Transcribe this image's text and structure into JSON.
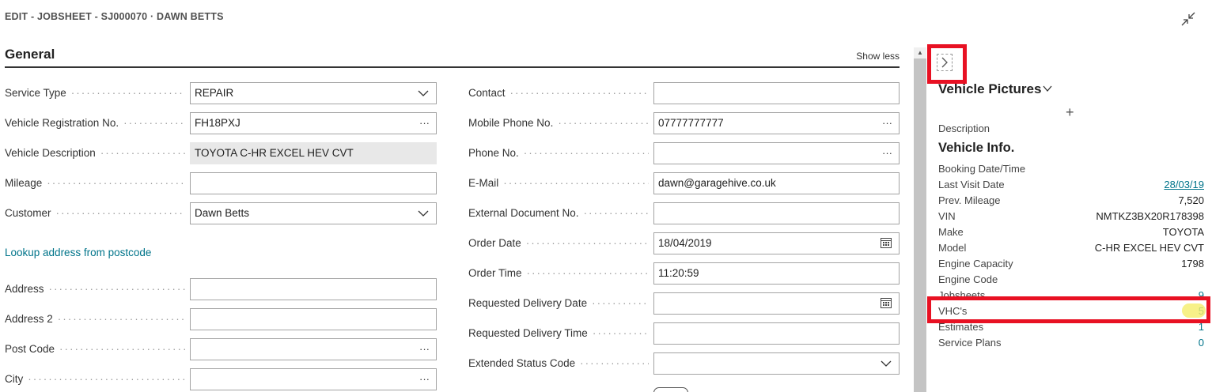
{
  "page": {
    "title": "EDIT - JOBSHEET - SJ000070 · DAWN BETTS",
    "collapse_icon": "collapse-arrows-icon"
  },
  "section": {
    "title": "General",
    "show_less": "Show less"
  },
  "left_fields": [
    {
      "label": "Service Type",
      "value": "REPAIR",
      "suffix": "chevron"
    },
    {
      "label": "Vehicle Registration No.",
      "value": "FH18PXJ",
      "suffix": "···"
    },
    {
      "label": "Vehicle Description",
      "value": "TOYOTA C-HR EXCEL HEV CVT",
      "suffix": ""
    },
    {
      "label": "Mileage",
      "value": "",
      "suffix": ""
    },
    {
      "label": "Customer",
      "value": "Dawn Betts",
      "suffix": "chevron"
    }
  ],
  "lookup_link": "Lookup address from postcode",
  "address_fields": [
    {
      "label": "Address",
      "value": "",
      "suffix": ""
    },
    {
      "label": "Address 2",
      "value": "",
      "suffix": ""
    },
    {
      "label": "Post Code",
      "value": "",
      "suffix": "···"
    },
    {
      "label": "City",
      "value": "",
      "suffix": "···"
    }
  ],
  "right_fields": [
    {
      "label": "Contact",
      "value": "",
      "suffix": ""
    },
    {
      "label": "Mobile Phone No.",
      "value": "07777777777",
      "suffix": "···"
    },
    {
      "label": "Phone No.",
      "value": "",
      "suffix": "···"
    },
    {
      "label": "E-Mail",
      "value": "dawn@garagehive.co.uk",
      "suffix": ""
    },
    {
      "label": "External Document No.",
      "value": "",
      "suffix": ""
    },
    {
      "label": "Order Date",
      "value": "18/04/2019",
      "suffix": "calendar"
    },
    {
      "label": "Order Time",
      "value": "11:20:59",
      "suffix": ""
    },
    {
      "label": "Requested Delivery Date",
      "value": "",
      "suffix": "calendar"
    },
    {
      "label": "Requested Delivery Time",
      "value": "",
      "suffix": ""
    },
    {
      "label": "Extended Status Code",
      "value": "",
      "suffix": "chevron"
    }
  ],
  "factbox": {
    "heading": "Vehicle Pictures",
    "add_label": "+",
    "description_label": "Description",
    "vehicle_info_title": "Vehicle Info.",
    "rows": [
      {
        "key": "Booking Date/Time",
        "value": "",
        "style": ""
      },
      {
        "key": "Last Visit Date",
        "value": "28/03/19",
        "style": "link"
      },
      {
        "key": "Prev. Mileage",
        "value": "7,520",
        "style": ""
      },
      {
        "key": "VIN",
        "value": "NMTKZ3BX20R178398",
        "style": ""
      },
      {
        "key": "Make",
        "value": "TOYOTA",
        "style": ""
      },
      {
        "key": "Model",
        "value": "C-HR EXCEL HEV CVT",
        "style": ""
      },
      {
        "key": "Engine Capacity",
        "value": "1798",
        "style": ""
      },
      {
        "key": "Engine Code",
        "value": "",
        "style": ""
      },
      {
        "key": "Jobsheets",
        "value": "9",
        "style": "teal"
      },
      {
        "key": "VHC's",
        "value": "5",
        "style": "teal"
      },
      {
        "key": "Estimates",
        "value": "1",
        "style": "teal"
      },
      {
        "key": "Service Plans",
        "value": "0",
        "style": "teal"
      }
    ]
  },
  "colors": {
    "accent_link": "#00748a",
    "annotation_red": "#e81123",
    "highlight_yellow": "#f5ee6a"
  }
}
